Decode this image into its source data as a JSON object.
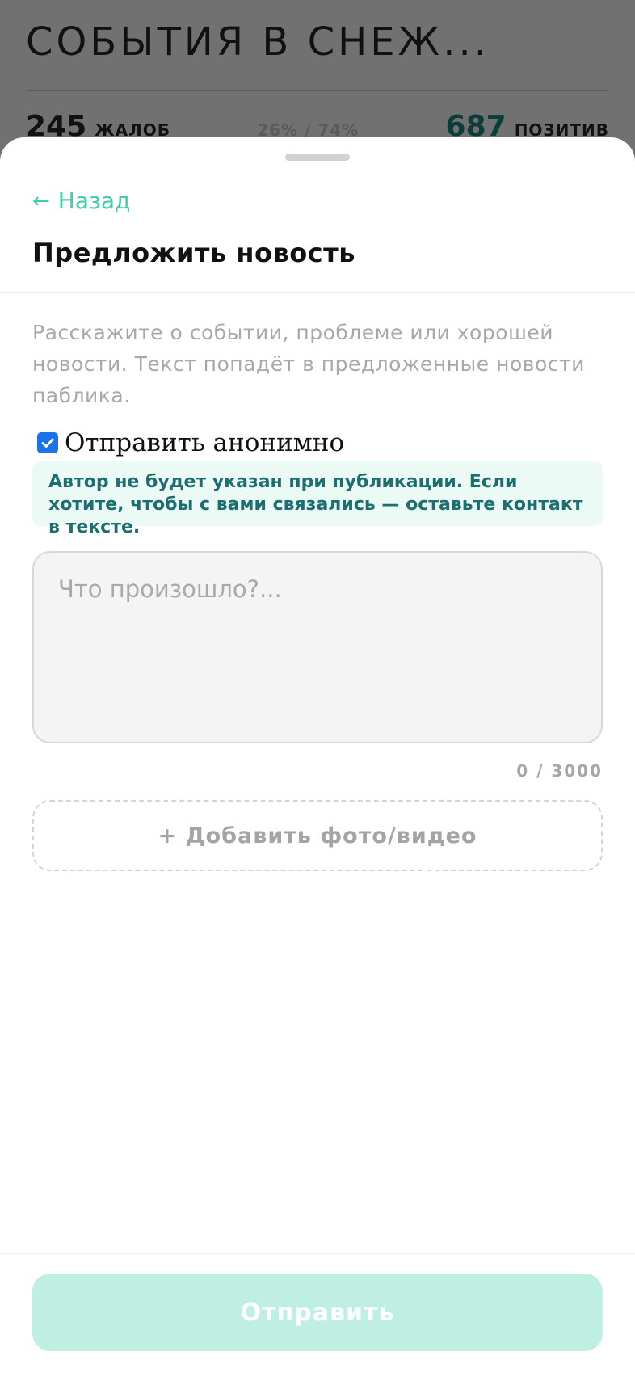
{
  "background": {
    "title": "СОБЫТИЯ В СНЕЖ...",
    "complaints_count": "245",
    "complaints_label": "жалоб",
    "ratio": "26% / 74%",
    "positive_count": "687",
    "positive_label": "позитив"
  },
  "sheet": {
    "back_label": "Назад",
    "title": "Предложить новость",
    "intro": "Расскажите о событии, проблеме или хорошей новости. Текст попадёт в предложенные новости паблика.",
    "anonymous_label": "Отправить анонимно",
    "anonymous_checked": true,
    "info_text": "Автор не будет указан при публикации. Если хотите, чтобы с вами связались — оставьте контакт в тексте.",
    "textarea_placeholder": "Что произошло?...",
    "textarea_value": "",
    "counter": "0 / 3000",
    "add_media_label": "+ Добавить фото/видео",
    "submit_label": "Отправить"
  },
  "colors": {
    "accent": "#3fcfa6",
    "info_bg": "#ecfaf6",
    "info_text": "#1c6e70",
    "submit_disabled": "#bfefe2",
    "checkbox": "#1a73e8"
  },
  "icons": {
    "back": "arrow-left-icon",
    "checkbox": "checkmark-icon"
  }
}
